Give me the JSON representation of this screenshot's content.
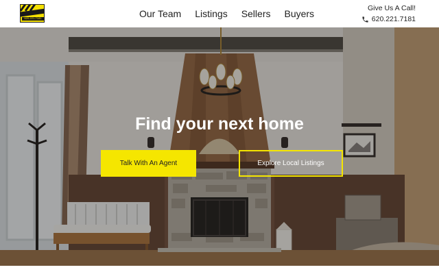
{
  "header": {
    "logo_text": "RIVER CITY",
    "logo_phone": "620-221-7181",
    "nav": [
      {
        "label": "Our Team"
      },
      {
        "label": "Listings"
      },
      {
        "label": "Sellers"
      },
      {
        "label": "Buyers"
      }
    ],
    "call_label": "Give Us A Call!",
    "phone": "620.221.7181",
    "phone_icon": "phone-icon"
  },
  "hero": {
    "title": "Find your next home",
    "primary_button": "Talk With An Agent",
    "secondary_button": "Explore Local Listings",
    "background": "living-room-with-stone-fireplace"
  },
  "colors": {
    "accent": "#f5e600",
    "text_dark": "#222222",
    "text_light": "#ffffff"
  }
}
